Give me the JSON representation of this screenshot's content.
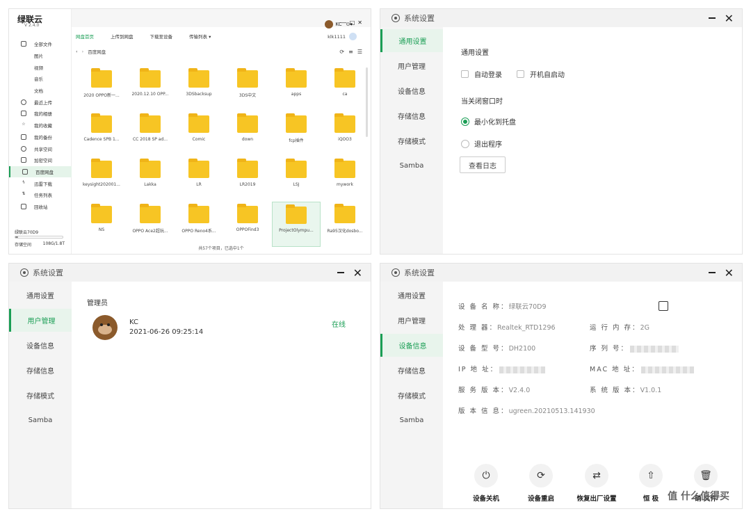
{
  "file_manager": {
    "app_title": "绿联云",
    "version": "V 2.4.0",
    "user_name": "KC",
    "account": "klk1111",
    "nav": [
      "全部文件",
      "图片",
      "视频",
      "音乐",
      "文档",
      "最近上传",
      "我的相册",
      "我的收藏",
      "我的备份",
      "共享空间",
      "加密空间",
      "百度网盘",
      "迅雷下载",
      "任务列表",
      "回收站"
    ],
    "tabs": [
      "网盘首页",
      "上传到网盘",
      "下载至设备",
      "传输列表 ▾"
    ],
    "breadcrumb": "百度网盘",
    "device": "绿联云70D9",
    "storage_label": "存储空间",
    "storage_value": "108G/1.8T",
    "storage_used_fraction": 0.06,
    "folders": [
      "2020 OPPO新一...",
      "2020.12.10 OPP...",
      "3DSbacksup",
      "3DS中文",
      "apps",
      "ca",
      "Cadence SPB 1...",
      "CC 2018 SP ad...",
      "Comic",
      "down",
      "fcp插件",
      "iQOO3",
      "keysight202001...",
      "Lakka",
      "LR",
      "LR2019",
      "LSJ",
      "mywork",
      "NS",
      "OPPO Ace2超玩...",
      "OPPO Reno4系...",
      "OPPOFind3",
      "ProjectOlympu...",
      "Ra95汉化dosbo..."
    ],
    "footer": "共57个项目，已选中1个"
  },
  "settings_nav": [
    "通用设置",
    "用户管理",
    "设备信息",
    "存储信息",
    "存储模式",
    "Samba"
  ],
  "dialog_title": "系统设置",
  "general": {
    "heading": "通用设置",
    "auto_login": "自动登录",
    "auto_start": "开机自启动",
    "close_heading": "当关闭窗口时",
    "minimize": "最小化到托盘",
    "exit": "退出程序",
    "log_button": "查看日志"
  },
  "users": {
    "heading": "管理员",
    "name": "KC",
    "time": "2021-06-26 09:25:14",
    "status": "在线"
  },
  "device": {
    "name_label": "设 备 名 称：",
    "name_value": "绿联云70D9",
    "cpu_label": "处 理 器：",
    "cpu_value": "Realtek_RTD1296",
    "mem_label": "运 行 内 存：",
    "mem_value": "2G",
    "model_label": "设 备 型 号：",
    "model_value": "DH2100",
    "serial_label": "序 列 号：",
    "ip_label": "IP 地 址：",
    "mac_label": "MAC 地 址：",
    "svc_label": "服 务 版 本：",
    "svc_value": "V2.4.0",
    "sys_label": "系 统 版 本：",
    "sys_value": "V1.0.1",
    "ver_label": "版 本 信 息：",
    "ver_value": "ugreen.20210513.141930",
    "actions": [
      "设备关机",
      "设备重启",
      "恢复出厂设置",
      "恒  极",
      "硝 文件"
    ]
  },
  "watermark": "值 什么值得买"
}
